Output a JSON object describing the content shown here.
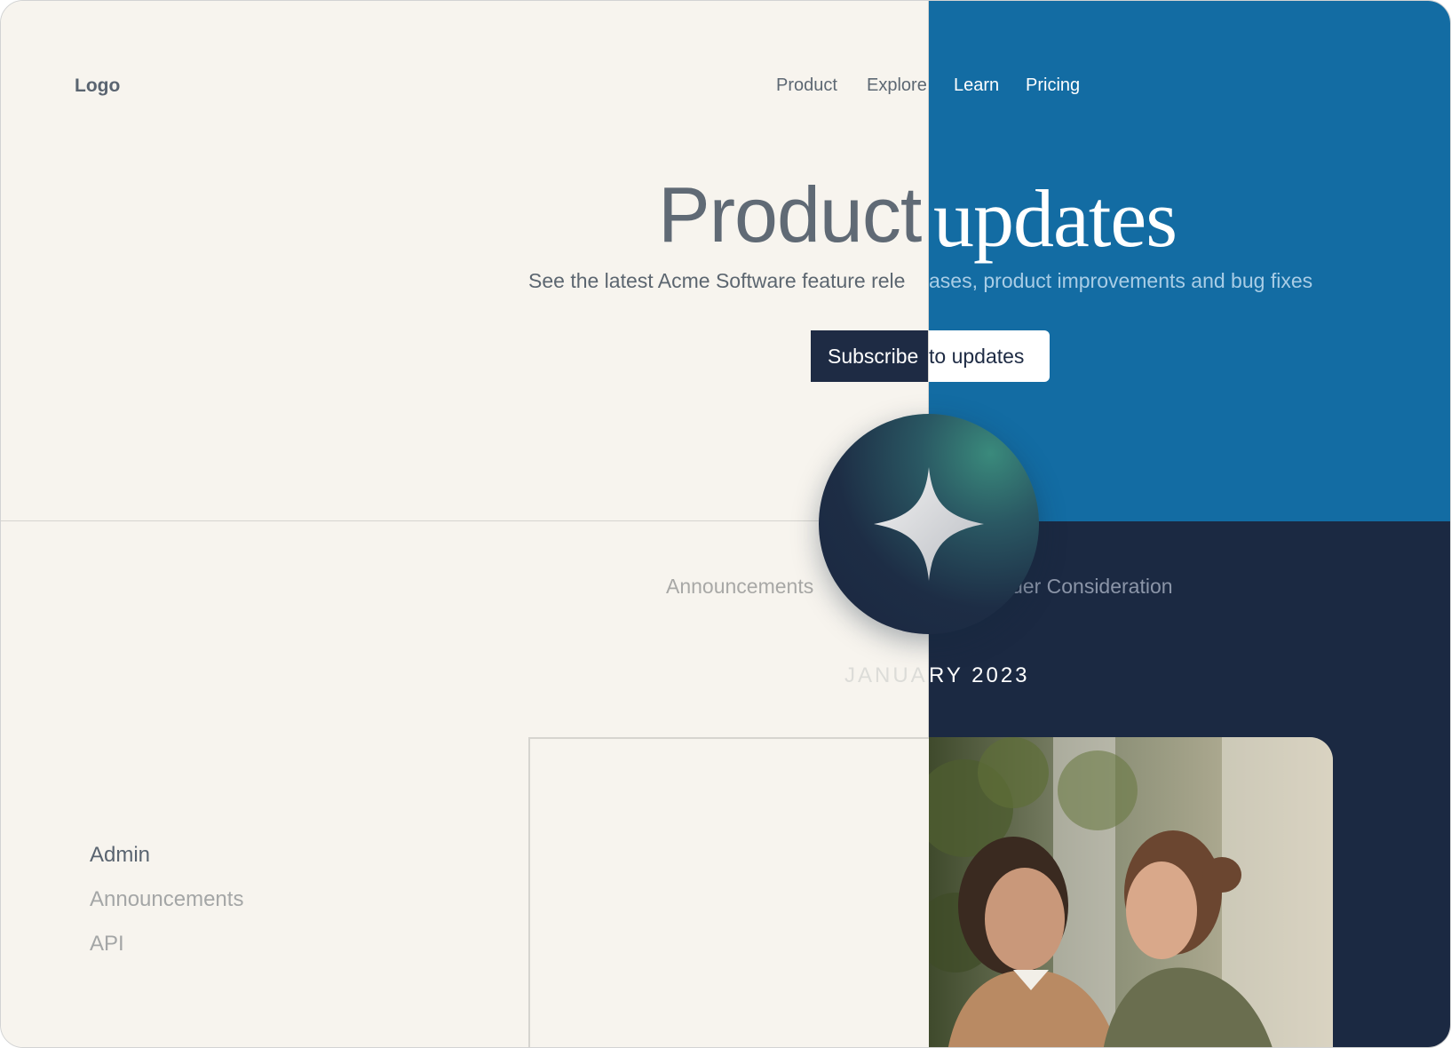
{
  "header": {
    "logo": "Logo",
    "nav": [
      "Product",
      "Explore",
      "Learn",
      "Pricing"
    ]
  },
  "hero": {
    "title_left": "Product",
    "title_right": "updates",
    "subtitle_left": "See the latest Acme Software feature rele",
    "subtitle_right": "ases, product improvements and bug fixes",
    "cta_left": "Subscribe",
    "cta_right": "to updates"
  },
  "tabs": {
    "left": "Announcements",
    "right": "der Consideration"
  },
  "section": {
    "month_left": "JANUA",
    "month_right": "RY 2023"
  },
  "sidebar": {
    "items": [
      "Admin",
      "Announcements",
      "API"
    ]
  },
  "icons": {
    "badge": "sparkle-icon"
  },
  "colors": {
    "cream": "#f7f4ee",
    "blue": "#136ca3",
    "navy": "#1b2942",
    "slate": "#5c6670"
  }
}
